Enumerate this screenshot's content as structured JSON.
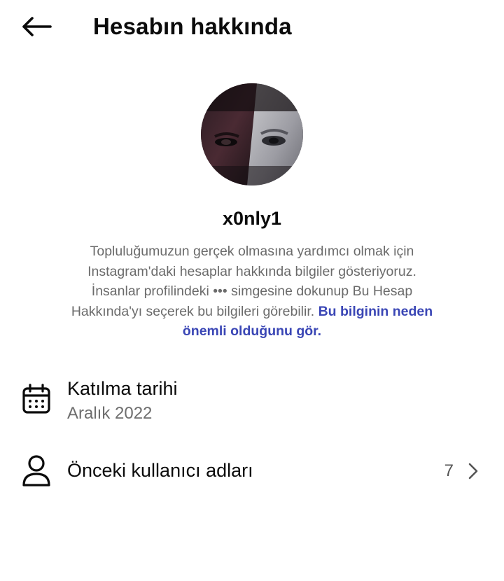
{
  "header": {
    "title": "Hesabın hakkında",
    "back_icon": "arrow-left-icon"
  },
  "profile": {
    "username": "x0nly1",
    "avatar_icon": "profile-photo"
  },
  "description": {
    "lines": [
      "Topluluğumuzun gerçek olmasına yardımcı olmak için",
      "Instagram'daki hesaplar hakkında bilgiler gösteriyoruz.",
      "İnsanlar profilindeki ••• simgesine dokunup Bu Hesap",
      "Hakkında'yı seçerek bu bilgileri görebilir."
    ],
    "link_part1": "Bu bilginin neden",
    "link_part2": "önemli olduğunu gör.",
    "link_color": "#3a46b5"
  },
  "rows": {
    "date_joined": {
      "title": "Katılma tarihi",
      "value": "Aralık 2022",
      "icon": "calendar-icon"
    },
    "former_usernames": {
      "title": "Önceki kullanıcı adları",
      "count": "7",
      "icon": "user-icon",
      "chevron": "chevron-right-icon"
    }
  }
}
